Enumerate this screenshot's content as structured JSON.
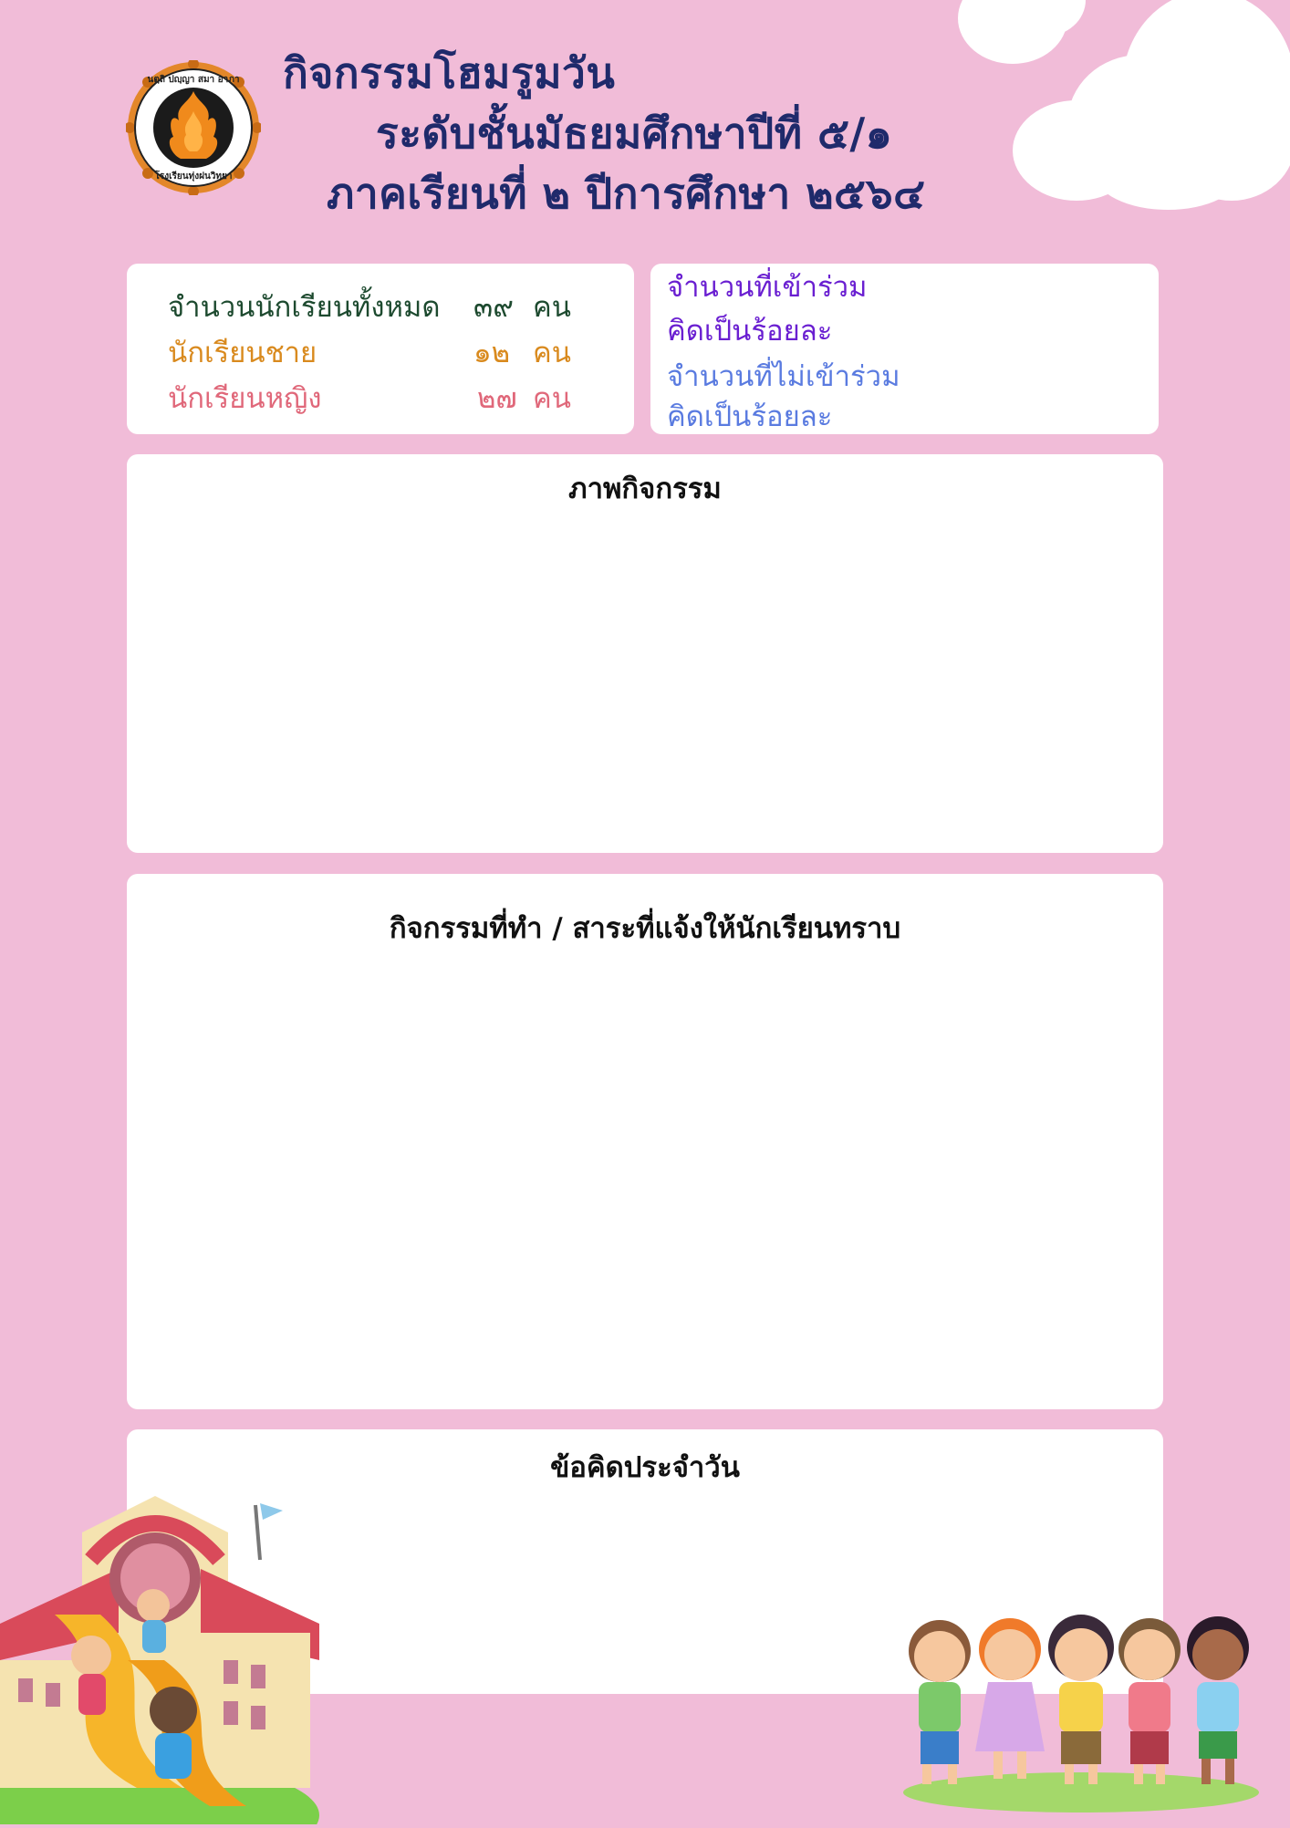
{
  "header": {
    "title_line1": "กิจกรรมโฮมรูมวัน",
    "title_line2": "ระดับชั้นมัธยมศึกษาปีที่ ๕/๑",
    "title_line3": "ภาคเรียนที่ ๒  ปีการศึกษา ๒๕๖๔",
    "logo": {
      "text_top": "นตฺถิ ปญฺญา สมา อาภา",
      "text_bottom": "โรงเรียนทุ่งฝนวิทยา",
      "icon": "school-emblem-icon"
    }
  },
  "student_stats": {
    "total_label": "จำนวนนักเรียนทั้งหมด",
    "total_value": "๓๙",
    "total_unit": "คน",
    "male_label": "นักเรียนชาย",
    "male_value": "๑๒",
    "male_unit": "คน",
    "female_label": "นักเรียนหญิง",
    "female_value": "๒๗",
    "female_unit": "คน"
  },
  "attendance": {
    "present_label": "จำนวนที่เข้าร่วม",
    "present_percent_label": "คิดเป็นร้อยละ",
    "absent_label": "จำนวนที่ไม่เข้าร่วม",
    "absent_percent_label": "คิดเป็นร้อยละ"
  },
  "sections": {
    "photos_heading": "ภาพกิจกรรม",
    "activities_heading": "กิจกรรมที่ทำ / สาระที่แจ้งให้นักเรียนทราบ",
    "thought_heading": "ข้อคิดประจำวัน"
  },
  "colors": {
    "background": "#f1bcd8",
    "title": "#1f2a6b",
    "total": "#1d4a2f",
    "male": "#d98a1e",
    "female": "#e0687a",
    "present": "#6a1fd1",
    "absent": "#5a7be0"
  }
}
